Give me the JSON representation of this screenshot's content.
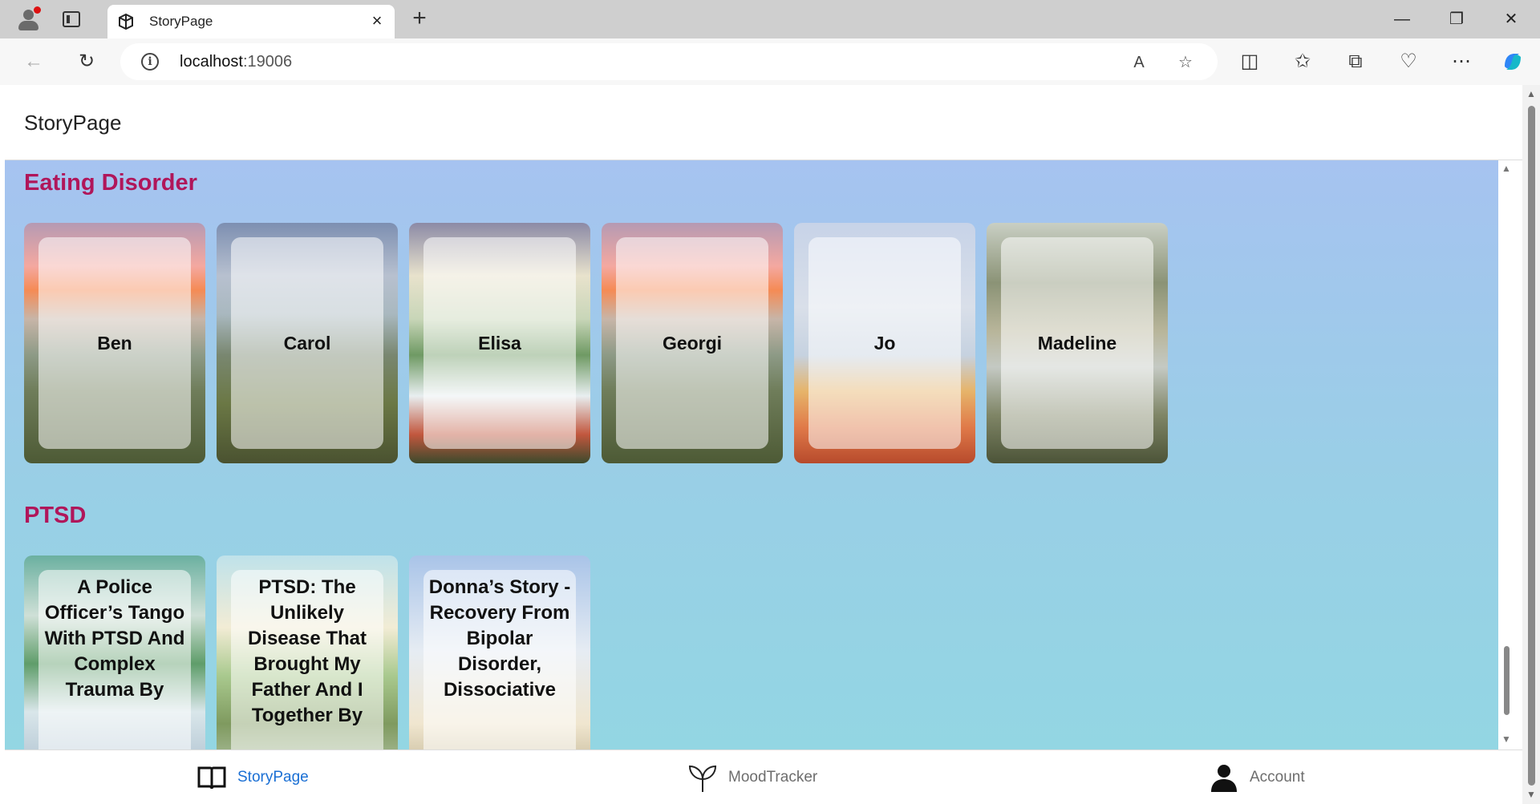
{
  "browser": {
    "tab_title": "StoryPage",
    "url_host": "localhost",
    "url_port": ":19006",
    "close_glyph": "×",
    "new_tab_glyph": "+"
  },
  "app": {
    "title": "StoryPage"
  },
  "sections": [
    {
      "title": "Eating Disorder",
      "cards": [
        {
          "name": "Ben",
          "background": "sunset-meadow"
        },
        {
          "name": "Carol",
          "background": "moon-meadow"
        },
        {
          "name": "Elisa",
          "background": "sunlit-wildflowers"
        },
        {
          "name": "Georgi",
          "background": "sunset-meadow"
        },
        {
          "name": "Jo",
          "background": "flower-bouquet"
        },
        {
          "name": "Madeline",
          "background": "mountain-river"
        }
      ]
    },
    {
      "title": "PTSD",
      "cards": [
        {
          "name": "A Police Officer’s Tango With PTSD And Complex Trauma By",
          "background": "coastal-meadow"
        },
        {
          "name": "PTSD: The Unlikely Disease That Brought My Father And I Together By",
          "background": "rolling-hills"
        },
        {
          "name": "Donna’s Story - Recovery From Bipolar Disorder, Dissociative",
          "background": "sky-field"
        }
      ]
    }
  ],
  "bottom_nav": {
    "items": [
      {
        "label": "StoryPage",
        "icon": "book-icon",
        "active": true
      },
      {
        "label": "MoodTracker",
        "icon": "sprout-icon",
        "active": false
      },
      {
        "label": "Account",
        "icon": "person-icon",
        "active": false
      }
    ]
  },
  "colors": {
    "section_title": "#b0165a",
    "nav_active": "#1a6fd4",
    "nav_inactive": "#6d6d6d",
    "content_bg_top": "#a6c3f0",
    "content_bg_bottom": "#93d6e3"
  }
}
